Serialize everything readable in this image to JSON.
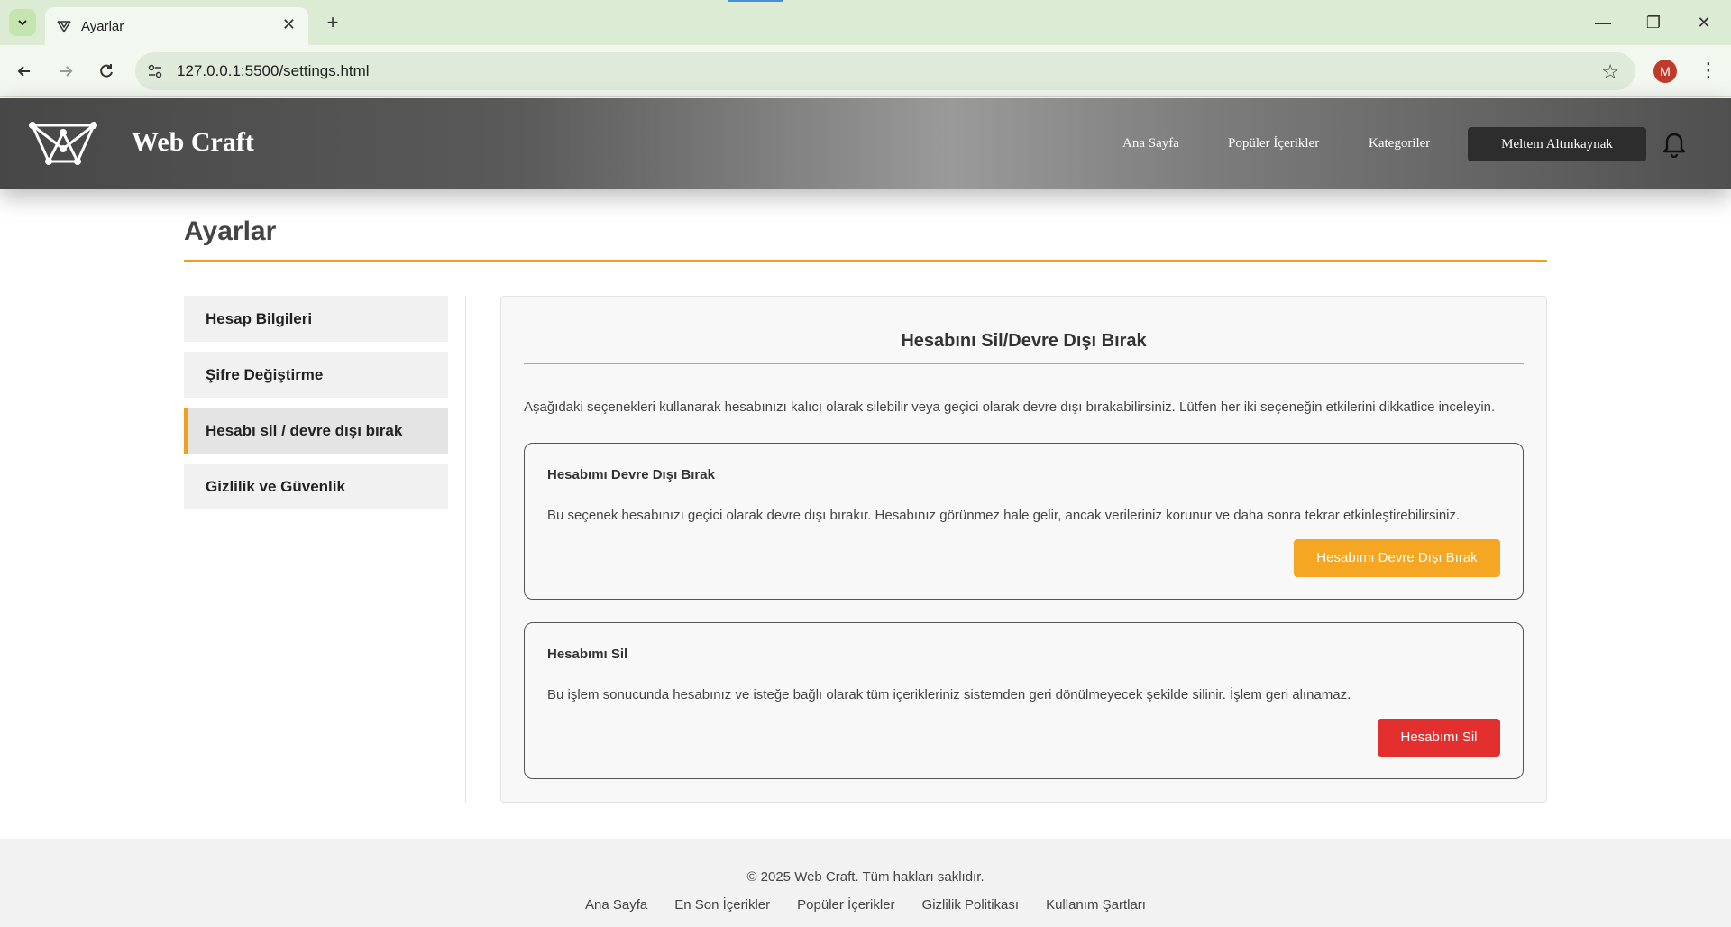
{
  "browser": {
    "tab_title": "Ayarlar",
    "url": "127.0.0.1:5500/settings.html",
    "profile_initial": "M"
  },
  "header": {
    "brand": "Web Craft",
    "nav": [
      "Ana Sayfa",
      "Popüler İçerikler",
      "Kategoriler"
    ],
    "user_name": "Meltem Altınkaynak"
  },
  "page": {
    "title": "Ayarlar"
  },
  "sidebar": {
    "items": [
      {
        "label": "Hesap Bilgileri"
      },
      {
        "label": "Şifre Değiştirme"
      },
      {
        "label": "Hesabı sil / devre dışı bırak"
      },
      {
        "label": "Gizlilik ve Güvenlik"
      }
    ],
    "active_index": 2
  },
  "panel": {
    "title": "Hesabını Sil/Devre Dışı Bırak",
    "description": "Aşağıdaki seçenekleri kullanarak hesabınızı kalıcı olarak silebilir veya geçici olarak devre dışı bırakabilirsiniz. Lütfen her iki seçeneğin etkilerini dikkatlice inceleyin.",
    "deactivate": {
      "title": "Hesabımı Devre Dışı Bırak",
      "text": "Bu seçenek hesabınızı geçici olarak devre dışı bırakır. Hesabınız görünmez hale gelir, ancak verileriniz korunur ve daha sonra tekrar etkinleştirebilirsiniz.",
      "button": "Hesabımı Devre Dışı Bırak"
    },
    "delete": {
      "title": "Hesabımı Sil",
      "text": "Bu işlem sonucunda hesabınız ve isteğe bağlı olarak tüm içerikleriniz sistemden geri dönülmeyecek şekilde silinir. İşlem geri alınamaz.",
      "button": "Hesabımı Sil"
    }
  },
  "footer": {
    "copyright": "© 2025 Web Craft. Tüm hakları saklıdır.",
    "links": [
      "Ana Sayfa",
      "En Son İçerikler",
      "Popüler İçerikler",
      "Gizlilik Politikası",
      "Kullanım Şartları"
    ]
  },
  "colors": {
    "accent": "#f0a020",
    "warning_button": "#f5a623",
    "danger_button": "#e3302f",
    "user_button": "#2d2d2d"
  }
}
